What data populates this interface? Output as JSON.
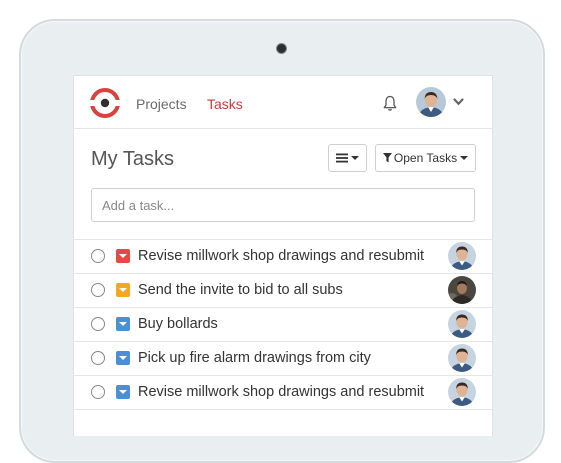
{
  "header": {
    "nav": [
      {
        "label": "Projects",
        "active": false
      },
      {
        "label": "Tasks",
        "active": true
      }
    ]
  },
  "main": {
    "title": "My Tasks",
    "filter_label": "Open Tasks",
    "add_task_placeholder": "Add a task..."
  },
  "colors": {
    "brand_red": "#c43d3d",
    "priority_high": "#e24b43",
    "priority_medium": "#f5a623",
    "priority_low": "#4a90d9"
  },
  "tasks": [
    {
      "title": "Revise millwork shop drawings and resubmit",
      "priority": "high",
      "assignee": "man-avatar"
    },
    {
      "title": "Send the invite to bid to all subs",
      "priority": "medium",
      "assignee": "dark-avatar"
    },
    {
      "title": "Buy bollards",
      "priority": "low",
      "assignee": "man-avatar"
    },
    {
      "title": "Pick up fire alarm drawings from city",
      "priority": "low",
      "assignee": "man-avatar"
    },
    {
      "title": "Revise millwork shop drawings and resubmit",
      "priority": "low",
      "assignee": "man-avatar"
    }
  ]
}
